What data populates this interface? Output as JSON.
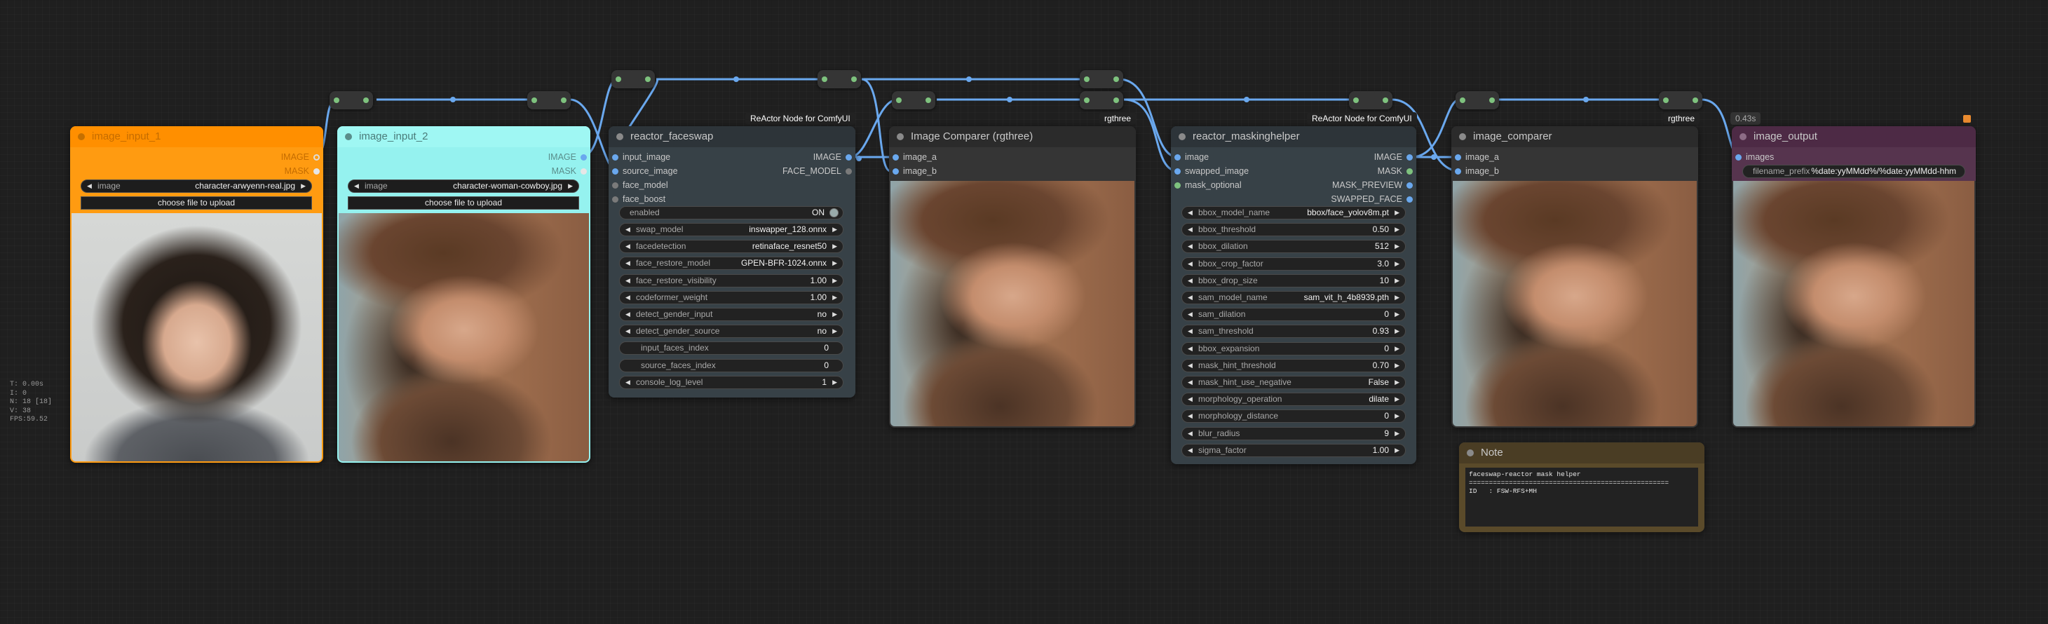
{
  "canvas": {
    "stats": {
      "t": "T: 0.00s",
      "i": "I: 0",
      "n": "N: 18 [18]",
      "v": "V: 38",
      "fps": "FPS:59.52"
    }
  },
  "nodes": {
    "image_input_1": {
      "title": "image_input_1",
      "outputs": [
        "IMAGE",
        "MASK"
      ],
      "image_widget": {
        "label": "image",
        "value": "character-arwyenn-real.jpg"
      },
      "upload_label": "choose file to upload",
      "color": "#ff9b11"
    },
    "image_input_2": {
      "title": "image_input_2",
      "outputs": [
        "IMAGE",
        "MASK"
      ],
      "image_widget": {
        "label": "image",
        "value": "character-woman-cowboy.jpg"
      },
      "upload_label": "choose file to upload",
      "color": "#95f2ef"
    },
    "reactor_faceswap": {
      "title": "reactor_faceswap",
      "badge": "ReActor Node for ComfyUI",
      "inputs": [
        "input_image",
        "source_image",
        "face_model",
        "face_boost"
      ],
      "outputs": [
        "IMAGE",
        "FACE_MODEL"
      ],
      "toggle": {
        "label": "enabled",
        "value": "ON"
      },
      "widgets": [
        {
          "label": "swap_model",
          "value": "inswapper_128.onnx",
          "type": "combo"
        },
        {
          "label": "facedetection",
          "value": "retinaface_resnet50",
          "type": "combo"
        },
        {
          "label": "face_restore_model",
          "value": "GPEN-BFR-1024.onnx",
          "type": "combo"
        },
        {
          "label": "face_restore_visibility",
          "value": "1.00",
          "type": "number"
        },
        {
          "label": "codeformer_weight",
          "value": "1.00",
          "type": "number"
        },
        {
          "label": "detect_gender_input",
          "value": "no",
          "type": "combo"
        },
        {
          "label": "detect_gender_source",
          "value": "no",
          "type": "combo"
        },
        {
          "label": "input_faces_index",
          "value": "0",
          "type": "text"
        },
        {
          "label": "source_faces_index",
          "value": "0",
          "type": "text"
        },
        {
          "label": "console_log_level",
          "value": "1",
          "type": "combo"
        }
      ]
    },
    "image_comparer_rg": {
      "title": "Image Comparer (rgthree)",
      "badge": "rgthree",
      "inputs": [
        "image_a",
        "image_b"
      ]
    },
    "reactor_maskinghelper": {
      "title": "reactor_maskinghelper",
      "badge": "ReActor Node for ComfyUI",
      "inputs": [
        "image",
        "swapped_image",
        "mask_optional"
      ],
      "outputs": [
        "IMAGE",
        "MASK",
        "MASK_PREVIEW",
        "SWAPPED_FACE"
      ],
      "widgets": [
        {
          "label": "bbox_model_name",
          "value": "bbox/face_yolov8m.pt"
        },
        {
          "label": "bbox_threshold",
          "value": "0.50"
        },
        {
          "label": "bbox_dilation",
          "value": "512"
        },
        {
          "label": "bbox_crop_factor",
          "value": "3.0"
        },
        {
          "label": "bbox_drop_size",
          "value": "10"
        },
        {
          "label": "sam_model_name",
          "value": "sam_vit_h_4b8939.pth"
        },
        {
          "label": "sam_dilation",
          "value": "0"
        },
        {
          "label": "sam_threshold",
          "value": "0.93"
        },
        {
          "label": "bbox_expansion",
          "value": "0"
        },
        {
          "label": "mask_hint_threshold",
          "value": "0.70"
        },
        {
          "label": "mask_hint_use_negative",
          "value": "False"
        },
        {
          "label": "morphology_operation",
          "value": "dilate"
        },
        {
          "label": "morphology_distance",
          "value": "0"
        },
        {
          "label": "blur_radius",
          "value": "9"
        },
        {
          "label": "sigma_factor",
          "value": "1.00"
        }
      ]
    },
    "image_comparer": {
      "title": "image_comparer",
      "badge": "rgthree",
      "inputs": [
        "image_a",
        "image_b"
      ]
    },
    "image_output": {
      "title": "image_output",
      "time_badge": "0.43s",
      "inputs": [
        "images"
      ],
      "prefix_widget": {
        "label": "filename_prefix",
        "value": "%date:yyMMdd%/%date:yyMMdd-hhm"
      },
      "color": "#4d2a45"
    },
    "note": {
      "title": "Note",
      "text": "faceswap-reactor mask helper\n==================================================\nID   : FSW-RFS+MH",
      "color": "#5a4a2a"
    }
  },
  "colors": {
    "link_image": "#6aa8ee",
    "reroute_pin": "#7ec27e",
    "canvas_bg": "#1f1f1f"
  }
}
